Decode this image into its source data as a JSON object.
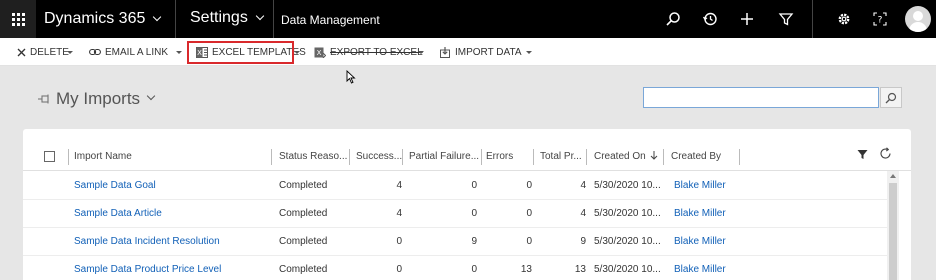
{
  "topbar": {
    "app_title": "Dynamics 365",
    "area_title": "Settings",
    "breadcrumb": "Data Management"
  },
  "commands": {
    "delete": "DELETE",
    "email_link": "EMAIL A LINK",
    "excel_templates": "EXCEL TEMPLATES",
    "export_excel": "EXPORT TO EXCEL",
    "import_data": "IMPORT DATA"
  },
  "view": {
    "title": "My Imports",
    "search_value": ""
  },
  "grid": {
    "headers": {
      "name": "Import Name",
      "status": "Status Reaso...",
      "success": "Success...",
      "partial": "Partial Failure...",
      "errors": "Errors",
      "total": "Total Pr...",
      "created_on": "Created On",
      "created_by": "Created By"
    },
    "rows": [
      {
        "name": "Sample Data Goal",
        "status": "Completed",
        "success": "4",
        "partial": "0",
        "errors": "0",
        "total": "4",
        "created_on": "5/30/2020 10...",
        "created_by": "Blake Miller"
      },
      {
        "name": "Sample Data Article",
        "status": "Completed",
        "success": "4",
        "partial": "0",
        "errors": "0",
        "total": "4",
        "created_on": "5/30/2020 10...",
        "created_by": "Blake Miller"
      },
      {
        "name": "Sample Data Incident Resolution",
        "status": "Completed",
        "success": "0",
        "partial": "9",
        "errors": "0",
        "total": "9",
        "created_on": "5/30/2020 10...",
        "created_by": "Blake Miller"
      },
      {
        "name": "Sample Data Product Price Level",
        "status": "Completed",
        "success": "0",
        "partial": "0",
        "errors": "13",
        "total": "13",
        "created_on": "5/30/2020 10...",
        "created_by": "Blake Miller"
      }
    ]
  },
  "colors": {
    "topbar": "#000000",
    "link": "#1160b7",
    "highlight": "#d9292c"
  }
}
